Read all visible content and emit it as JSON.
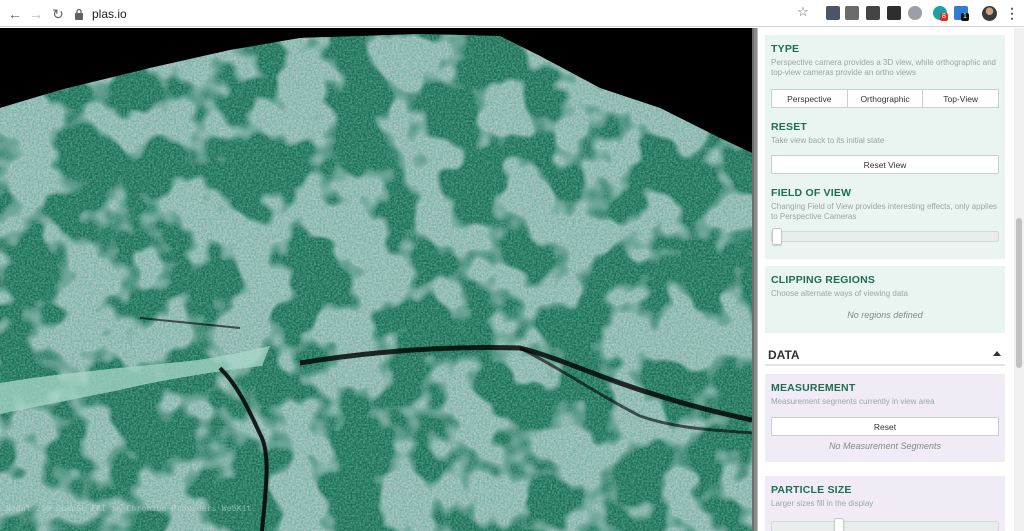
{
  "browser": {
    "url": "plas.io",
    "extensions": [
      {
        "name": "shield-extension-icon",
        "color": "#4a5566"
      },
      {
        "name": "keyboard-extension-icon",
        "color": "#6b6b6b"
      },
      {
        "name": "notes-extension-icon",
        "color": "#444444"
      },
      {
        "name": "layers-extension-icon",
        "color": "#2e2e2e"
      },
      {
        "name": "counter-extension-icon",
        "color": "#1aa3a3",
        "badge": "8",
        "badge_color": "#d93025"
      },
      {
        "name": "arch-extension-icon",
        "color": "#9aa0a6"
      },
      {
        "name": "tag-extension-icon",
        "color": "#2f7bd6",
        "badge": "1",
        "badge_color": "#111111"
      }
    ]
  },
  "viewport": {
    "attribution": "Nodul 200 OpenGL ERI in Chromium Providers WebKit",
    "colors": {
      "canopy": "#1c6b52",
      "canopy_light": "#2d8a6a",
      "ground": "#6f8e8a",
      "water": "#a9d8c9",
      "background": "#000000"
    }
  },
  "panel": {
    "type": {
      "title": "TYPE",
      "description": "Perspective camera provides a 3D view, while orthographic and top-view cameras provide an ortho views",
      "options": [
        "Perspective",
        "Orthographic",
        "Top-View"
      ]
    },
    "reset": {
      "title": "RESET",
      "description": "Take view back to its initial state",
      "button": "Reset View"
    },
    "field_of_view": {
      "title": "FIELD OF VIEW",
      "description": "Changing Field of View provides interesting effects, only applies to Perspective Cameras",
      "value": 0.0
    },
    "clipping": {
      "title": "CLIPPING REGIONS",
      "description": "Choose alternate ways of viewing data",
      "empty": "No regions defined"
    },
    "data_section": {
      "label": "DATA"
    },
    "measurement": {
      "title": "MEASUREMENT",
      "description": "Measurement segments currently in view area",
      "button": "Reset",
      "empty": "No Measurement Segments"
    },
    "particle_size": {
      "title": "PARTICLE SIZE",
      "description": "Larger sizes fill in the display"
    }
  }
}
